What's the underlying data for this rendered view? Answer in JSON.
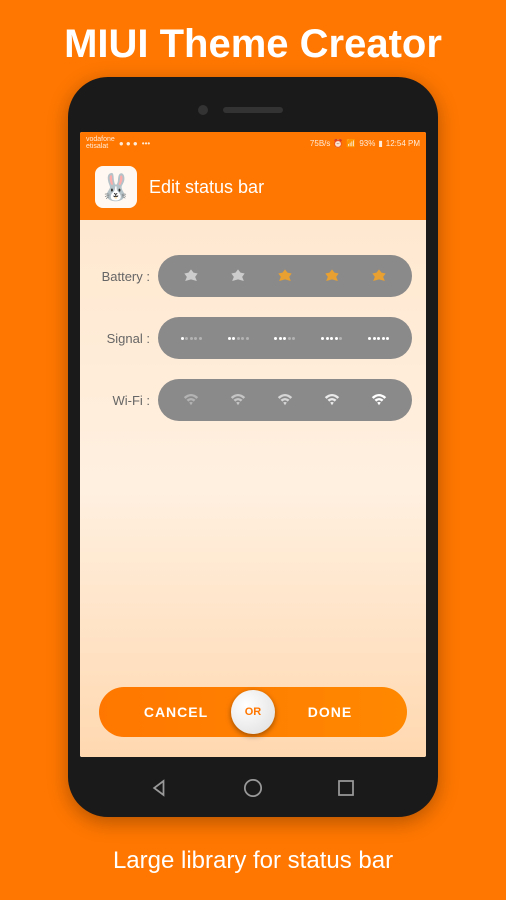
{
  "promo": {
    "title": "MIUI Theme Creator",
    "caption": "Large library for status bar"
  },
  "statusBar": {
    "carrier1": "vodafone",
    "carrier2": "etisalat",
    "speed": "75B/s",
    "batteryPercent": "93%",
    "time": "12:54 PM"
  },
  "header": {
    "title": "Edit status bar",
    "mascot": "🐰"
  },
  "options": {
    "battery": {
      "label": "Battery :"
    },
    "signal": {
      "label": "Signal :"
    },
    "wifi": {
      "label": "Wi-Fi :"
    }
  },
  "actions": {
    "cancel": "CANCEL",
    "or": "OR",
    "done": "DONE"
  },
  "leafColors": [
    "#cccccc",
    "#cccccc",
    "#e8a030",
    "#e8a030",
    "#e8a030"
  ],
  "wifiOpacities": [
    0.35,
    0.5,
    0.65,
    0.82,
    1.0
  ]
}
